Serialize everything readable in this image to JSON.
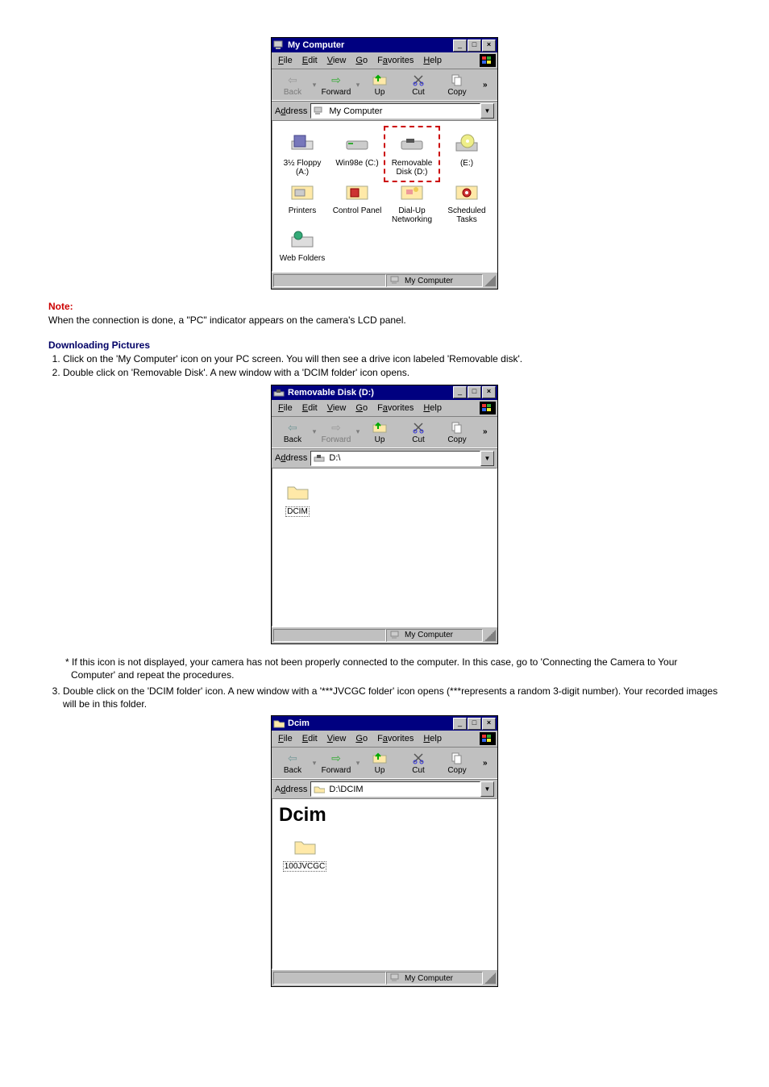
{
  "note": {
    "heading": "Note:",
    "text": "When the connection is done, a \"PC\" indicator appears on the camera's LCD panel."
  },
  "downloading": {
    "heading": "Downloading Pictures",
    "step1": "Click on the 'My Computer' icon on your PC screen. You will then see a drive icon labeled 'Removable disk'.",
    "step2": "Double click on 'Removable Disk'. A new window with a 'DCIM folder' icon opens.",
    "footnote1": "* If this icon is not displayed, your camera has not been properly connected to the computer. In this case, go to 'Connecting the Camera to Your Computer' and repeat the procedures.",
    "step3": "Double click on the 'DCIM folder' icon. A new window with a '***JVCGC folder' icon opens   (***represents a random 3-digit number). Your recorded images will be in this folder."
  },
  "labels": {
    "menu_file": "File",
    "menu_edit": "Edit",
    "menu_view": "View",
    "menu_go": "Go",
    "menu_favorites": "Favorites",
    "menu_help": "Help",
    "tb_back": "Back",
    "tb_forward": "Forward",
    "tb_up": "Up",
    "tb_cut": "Cut",
    "tb_copy": "Copy",
    "address": "Address",
    "status": "My Computer"
  },
  "win1": {
    "title": "My Computer",
    "address": "My Computer",
    "icons": {
      "floppy": "3½ Floppy (A:)",
      "winc": "Win98e (C:)",
      "removable": "Removable Disk (D:)",
      "e": "(E:)",
      "printers": "Printers",
      "cpl": "Control Panel",
      "dun": "Dial-Up Networking",
      "sched": "Scheduled Tasks",
      "web": "Web Folders"
    }
  },
  "win2": {
    "title": "Removable Disk (D:)",
    "address": "D:\\",
    "icons": {
      "dcim": "DCIM"
    }
  },
  "win3": {
    "title": "Dcim",
    "heading": "Dcim",
    "address": "D:\\DCIM",
    "icons": {
      "jvc": "100JVCGC"
    }
  }
}
